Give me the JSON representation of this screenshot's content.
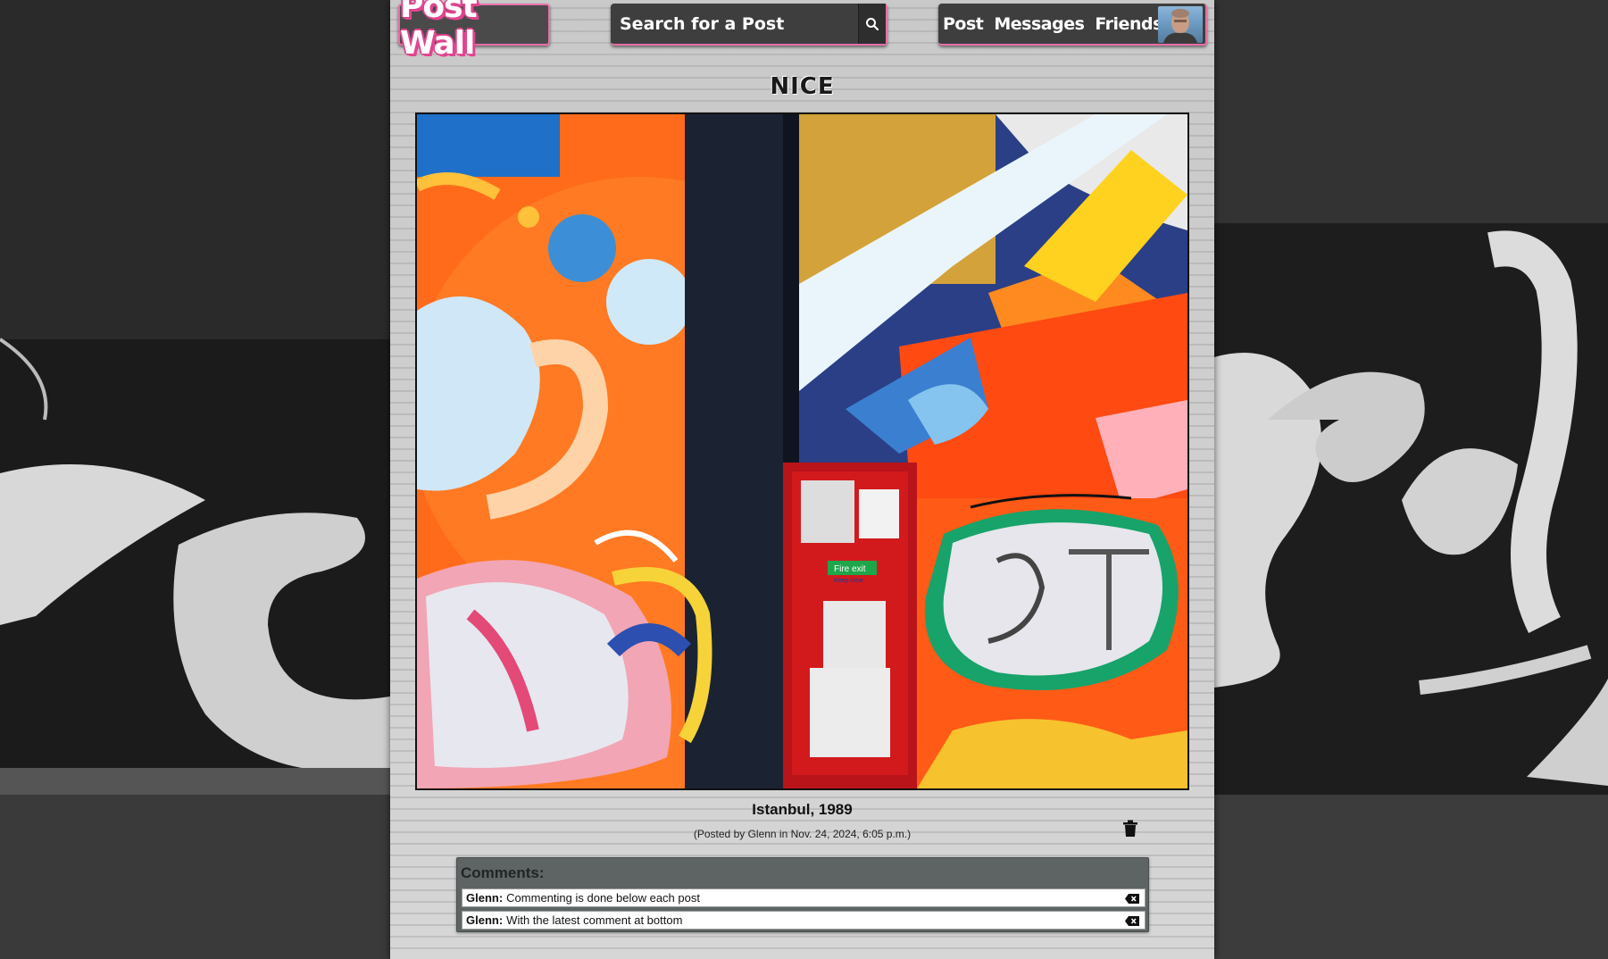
{
  "header": {
    "brand": "Post Wall",
    "search_placeholder": "Search for a Post",
    "nav": {
      "post": "Post",
      "messages": "Messages",
      "friends": "Friends"
    }
  },
  "post": {
    "title": "NICE",
    "caption": "Istanbul, 1989",
    "meta": "(Posted by Glenn in Nov. 24, 2024, 6:05 p.m.)",
    "image_signs": {
      "fire_exit": "Fire exit",
      "keep_clear": "Keep clear"
    }
  },
  "comments": {
    "title": "Comments:",
    "items": [
      {
        "author": "Glenn:",
        "text": "Commenting is done below each post"
      },
      {
        "author": "Glenn:",
        "text": "With the latest comment at bottom"
      }
    ]
  },
  "icons": {
    "search": "search-icon",
    "delete_post": "trash-icon",
    "delete_comment": "backspace-icon"
  },
  "colors": {
    "accent": "#e86fa8",
    "header_bg": "#3e3e3e",
    "column_bg": "#cfcfcf",
    "comments_bg": "#5e6464"
  }
}
